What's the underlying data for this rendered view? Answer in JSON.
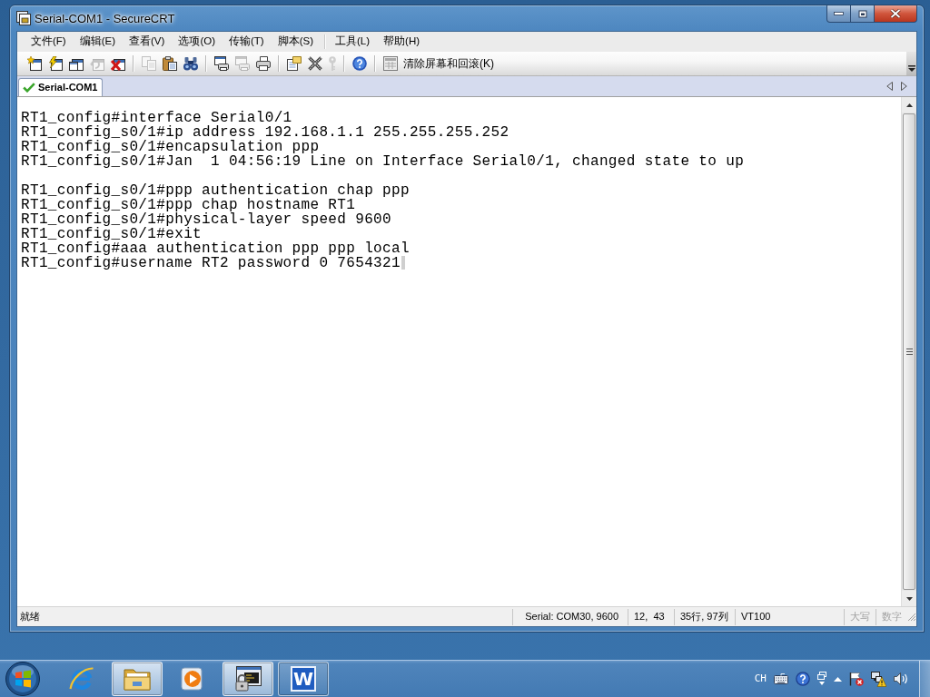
{
  "window": {
    "title": "Serial-COM1 - SecureCRT"
  },
  "menu_groups": [
    [
      "文件(F)",
      "编辑(E)",
      "查看(V)",
      "选项(O)",
      "传输(T)",
      "脚本(S)"
    ],
    [
      "工具(L)",
      "帮助(H)"
    ]
  ],
  "toolbar": {
    "groups": [
      [
        {
          "disabled": false
        },
        {
          "disabled": false
        },
        {
          "disabled": false
        },
        {
          "disabled": true
        },
        {
          "disabled": false
        }
      ],
      [
        {
          "disabled": true
        },
        {
          "disabled": false
        },
        {
          "disabled": false
        }
      ],
      [
        {
          "disabled": false
        },
        {
          "disabled": true
        },
        {
          "disabled": false
        }
      ],
      [
        {
          "disabled": false
        },
        {
          "disabled": false
        },
        {
          "disabled": true
        }
      ],
      [
        {
          "disabled": false
        }
      ]
    ],
    "clear_button": {
      "label": "清除屏幕和回滚(K)"
    }
  },
  "tabs": [
    {
      "label": "Serial-COM1",
      "selected": true,
      "connected": true
    }
  ],
  "terminal": {
    "blocks": [
      [
        "RT1_config#interface Serial0/1",
        "RT1_config_s0/1#ip address 192.168.1.1 255.255.255.252",
        "RT1_config_s0/1#encapsulation ppp",
        "RT1_config_s0/1#Jan  1 04:56:19 Line on Interface Serial0/1, changed state to up"
      ],
      [
        "RT1_config_s0/1#ppp authentication chap ppp",
        "RT1_config_s0/1#ppp chap hostname RT1",
        "RT1_config_s0/1#physical-layer speed 9600",
        "RT1_config_s0/1#exit",
        "RT1_config#aaa authentication ppp ppp local",
        "RT1_config#username RT2 password 0 7654321"
      ]
    ],
    "cursor": true
  },
  "status_bar": {
    "message": "就绪",
    "panes": [
      {
        "text": "Serial: COM30, 9600",
        "enabled": true
      },
      {
        "text": "12,  43",
        "enabled": true
      },
      {
        "text": "35行, 97列",
        "enabled": true
      },
      {
        "text": "VT100",
        "enabled": true
      },
      {
        "text": "大写",
        "enabled": false
      },
      {
        "text": "数字",
        "enabled": false
      }
    ]
  },
  "taskbar": {
    "apps": [
      {
        "running": false,
        "active": false
      },
      {
        "running": true,
        "active": true
      },
      {
        "running": false,
        "active": false
      },
      {
        "running": true,
        "active": true
      },
      {
        "running": true,
        "active": false,
        "label": "W"
      }
    ],
    "tray": {
      "language": "CH"
    }
  }
}
